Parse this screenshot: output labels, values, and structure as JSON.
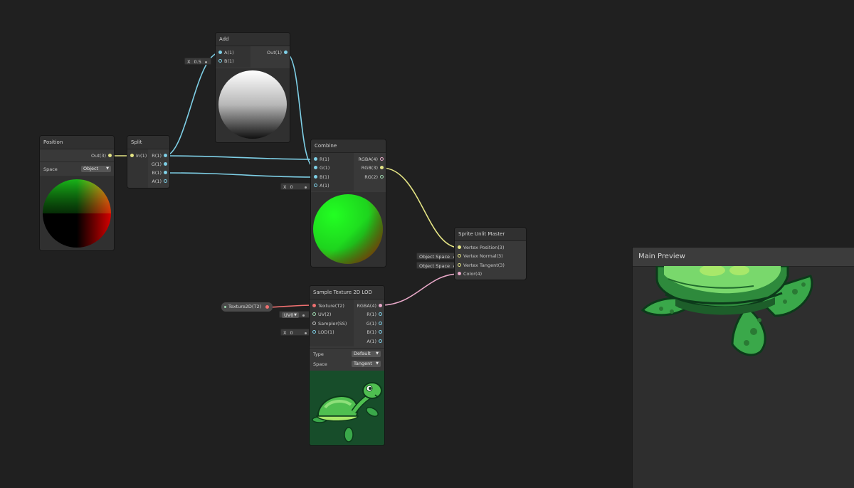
{
  "colors": {
    "canvas": "#202020",
    "node": "#393939",
    "wire_blue": "#7ecfe6",
    "wire_yellow": "#e4e484",
    "wire_pink": "#e8a8c8",
    "wire_red": "#ee7070"
  },
  "nodes": {
    "position": {
      "title": "Position",
      "out": "Out(3)",
      "space_label": "Space",
      "space_value": "Object"
    },
    "split": {
      "title": "Split",
      "in": "In(1)",
      "outs": [
        "R(1)",
        "G(1)",
        "B(1)",
        "A(1)"
      ]
    },
    "add": {
      "title": "Add",
      "ins": [
        "A(1)",
        "B(1)"
      ],
      "out": "Out(1)",
      "b_field_label": "X",
      "b_field_value": "0.5"
    },
    "combine": {
      "title": "Combine",
      "ins": [
        "R(1)",
        "G(1)",
        "B(1)",
        "A(1)"
      ],
      "outs": [
        "RGBA(4)",
        "RGB(3)",
        "RG(2)"
      ],
      "a_field_label": "X",
      "a_field_value": "0"
    },
    "master": {
      "title": "Sprite Unlit Master",
      "ins": [
        "Vertex Position(3)",
        "Vertex Normal(3)",
        "Vertex Tangent(3)",
        "Color(4)"
      ],
      "normal_field": "Object Space",
      "tangent_field": "Object Space"
    },
    "sample": {
      "title": "Sample Texture 2D LOD",
      "ins": [
        "Texture(T2)",
        "UV(2)",
        "Sampler(SS)",
        "LOD(1)"
      ],
      "outs": [
        "RGBA(4)",
        "R(1)",
        "G(1)",
        "B(1)",
        "A(1)"
      ],
      "uv_field": "UV0",
      "lod_field_label": "X",
      "lod_field_value": "0",
      "type_label": "Type",
      "type_value": "Default",
      "space_label": "Space",
      "space_value": "Tangent"
    },
    "texture_property": {
      "label": "Texture2D(T2)"
    }
  },
  "main_preview": {
    "title": "Main Preview"
  }
}
